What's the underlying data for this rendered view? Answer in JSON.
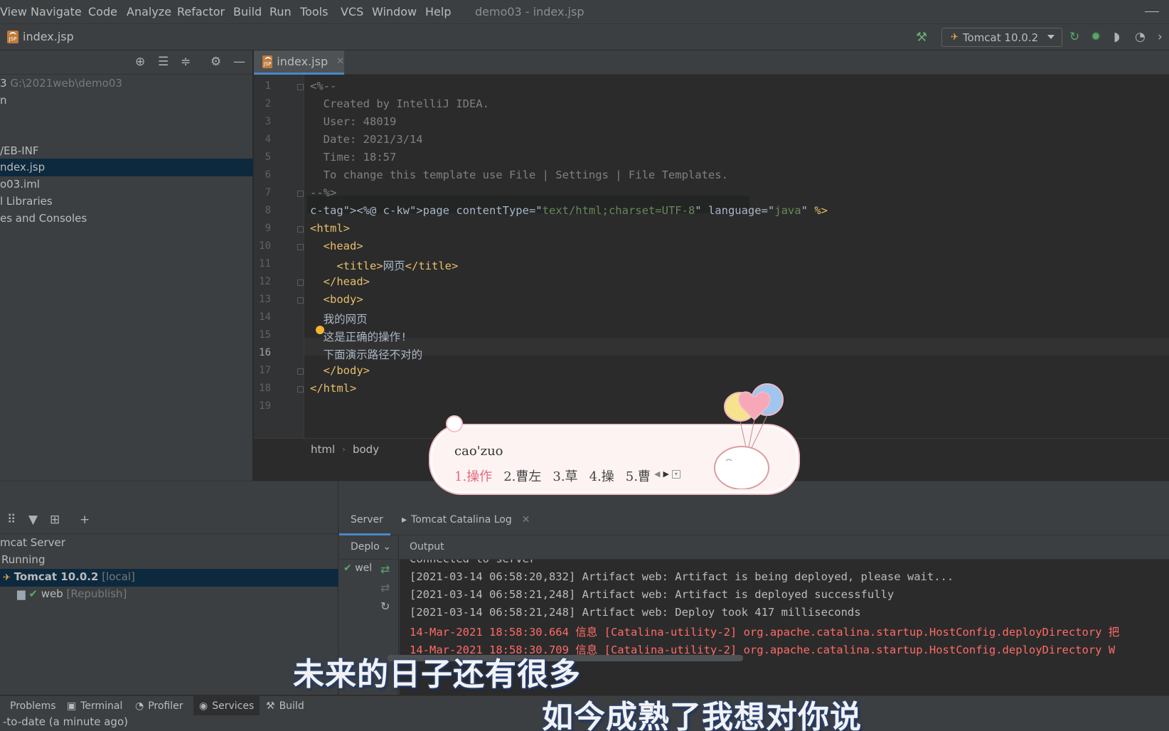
{
  "menubar": {
    "items": [
      "View",
      "Navigate",
      "Code",
      "Analyze",
      "Refactor",
      "Build",
      "Run",
      "Tools",
      "VCS",
      "Window",
      "Help"
    ],
    "window_title": "demo03 - index.jsp"
  },
  "navbar": {
    "file": "index.jsp",
    "run_config": "Tomcat 10.0.2"
  },
  "project": {
    "rows": [
      {
        "text": "3",
        "extra": "G:\\2021web\\demo03"
      },
      {
        "text": "n",
        "extra": ""
      },
      {
        "text": "",
        "extra": ""
      },
      {
        "text": "/EB-INF",
        "extra": ""
      },
      {
        "text": "ndex.jsp",
        "extra": ""
      },
      {
        "text": "o03.iml",
        "extra": ""
      },
      {
        "text": "l Libraries",
        "extra": ""
      },
      {
        "text": "es and Consoles",
        "extra": ""
      }
    ]
  },
  "editor": {
    "tab": "index.jsp",
    "current_line": 16,
    "breadcrumbs": [
      "html",
      "body"
    ],
    "lines": [
      {
        "n": "1",
        "text": "<%--"
      },
      {
        "n": "2",
        "text": "  Created by IntelliJ IDEA."
      },
      {
        "n": "3",
        "text": "  User: 48019"
      },
      {
        "n": "4",
        "text": "  Date: 2021/3/14"
      },
      {
        "n": "5",
        "text": "  Time: 18:57"
      },
      {
        "n": "6",
        "text": "  To change this template use File | Settings | File Templates."
      },
      {
        "n": "7",
        "text": "--%>"
      },
      {
        "n": "8",
        "text": "<%@ page contentType=\"text/html;charset=UTF-8\" language=\"java\" %>"
      },
      {
        "n": "9",
        "text": "<html>"
      },
      {
        "n": "10",
        "text": "  <head>"
      },
      {
        "n": "11",
        "text": "    <title>网页</title>"
      },
      {
        "n": "12",
        "text": "  </head>"
      },
      {
        "n": "13",
        "text": "  <body>"
      },
      {
        "n": "14",
        "text": "  我的网页"
      },
      {
        "n": "15",
        "text": "  这是正确的操作!"
      },
      {
        "n": "16",
        "text": "  下面演示路径不对的"
      },
      {
        "n": "17",
        "text": "  </body>"
      },
      {
        "n": "18",
        "text": "</html>"
      },
      {
        "n": "19",
        "text": ""
      }
    ],
    "colors": {
      "comment": "#808080",
      "tag": "#e8bf6a",
      "keyword": "#cc7832",
      "string": "#6a8759"
    }
  },
  "ime": {
    "input": "cao'zuo",
    "candidates": [
      "1.操作",
      "2.曹左",
      "3.草",
      "4.操",
      "5.曹"
    ]
  },
  "services": {
    "tree": [
      {
        "text": "mcat Server",
        "extra": ""
      },
      {
        "text": "Running",
        "extra": ""
      },
      {
        "text": "Tomcat 10.0.2",
        "extra": "[local]"
      },
      {
        "text": "web",
        "extra": "[Republish]"
      }
    ],
    "tabs": [
      "Server",
      "Tomcat Catalina Log"
    ],
    "deploy_label": "Deplo",
    "deploy_item": "wel",
    "output_label": "Output",
    "console": [
      {
        "text": "Connected to server",
        "level": "info"
      },
      {
        "text": "[2021-03-14 06:58:20,832] Artifact web: Artifact is being deployed, please wait...",
        "level": "info"
      },
      {
        "text": "[2021-03-14 06:58:21,248] Artifact web: Artifact is deployed successfully",
        "level": "info"
      },
      {
        "text": "[2021-03-14 06:58:21,248] Artifact web: Deploy took 417 milliseconds",
        "level": "info"
      },
      {
        "text": "14-Mar-2021 18:58:30.664 信息 [Catalina-utility-2] org.apache.catalina.startup.HostConfig.deployDirectory 把",
        "level": "error"
      },
      {
        "text": "14-Mar-2021 18:58:30.709 信息 [Catalina-utility-2] org.apache.catalina.startup.HostConfig.deployDirectory W",
        "level": "error"
      }
    ]
  },
  "toolstrip": {
    "buttons": [
      "Problems",
      "Terminal",
      "Profiler",
      "Services",
      "Build"
    ],
    "active": "Services"
  },
  "status": "-to-date (a minute ago)",
  "subtitles": [
    "未来的日子还有很多",
    "如今成熟了我想对你说"
  ]
}
